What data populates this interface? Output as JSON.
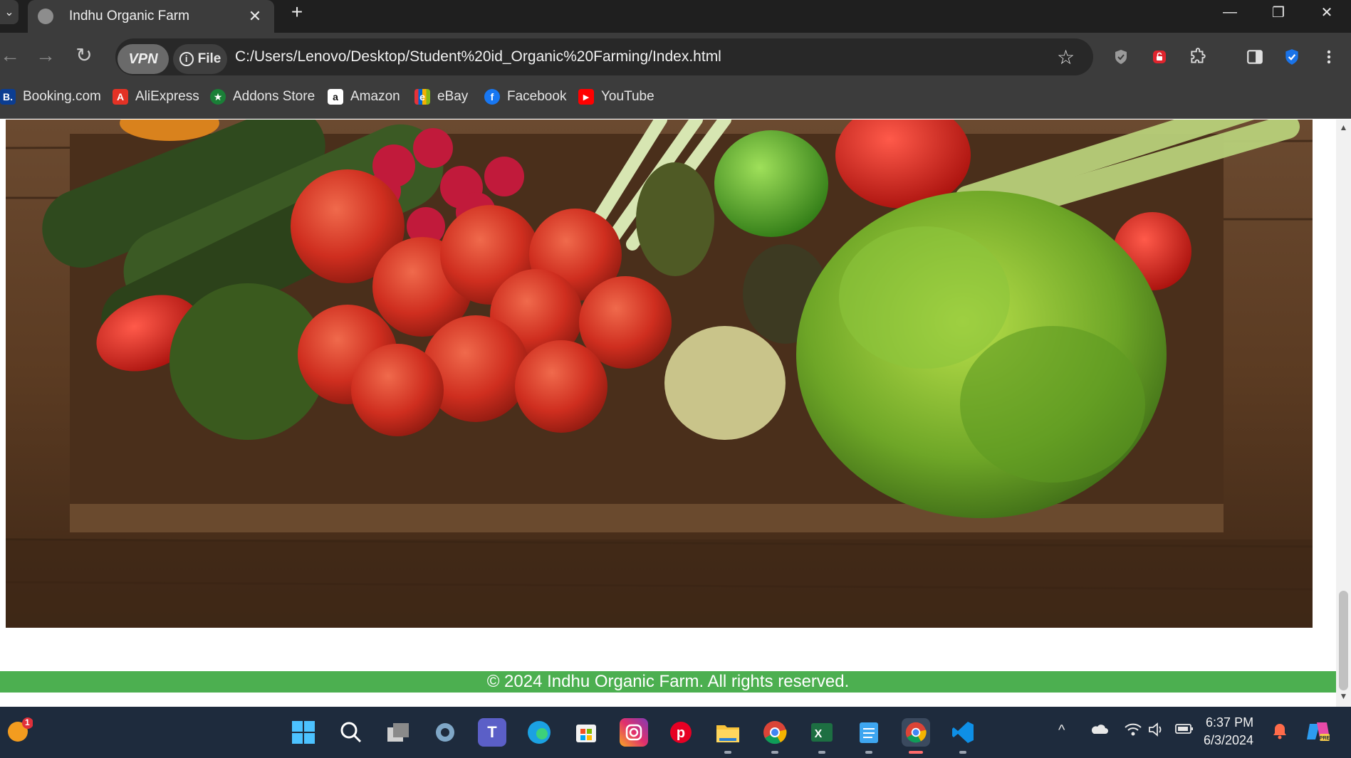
{
  "browser": {
    "tab_title": "Indhu Organic Farm",
    "tab_close": "✕",
    "new_tab": "+",
    "vpn_label": "VPN",
    "file_label": "File",
    "url": "C:/Users/Lenovo/Desktop/Student%20id_Organic%20Farming/Index.html",
    "window": {
      "minimize": "—",
      "restore": "❐",
      "close": "✕"
    },
    "nav": {
      "back": "←",
      "forward": "→",
      "reload": "↻"
    },
    "star": "☆",
    "extensions": [
      "shield-extension-icon",
      "lock-extension-icon",
      "puzzle-icon",
      "side-panel-icon",
      "shield-check-icon",
      "kebab-menu-icon"
    ]
  },
  "bookmarks": [
    {
      "label": "Booking.com",
      "icon": "B.",
      "color": "#0b3d91"
    },
    {
      "label": "AliExpress",
      "icon": "A",
      "color": "#e43225"
    },
    {
      "label": "Addons Store",
      "icon": "★",
      "color": "#1a7f37"
    },
    {
      "label": "Amazon",
      "icon": "a",
      "color": "#ffffff"
    },
    {
      "label": "eBay",
      "icon": "e",
      "color": "#e53238"
    },
    {
      "label": "Facebook",
      "icon": "f",
      "color": "#1877f2"
    },
    {
      "label": "YouTube",
      "icon": "▶",
      "color": "#ff0000"
    }
  ],
  "page": {
    "footer": "© 2024 Indhu Organic Farm. All rights reserved."
  },
  "taskbar": {
    "time": "6:37 PM",
    "date": "6/3/2024",
    "notification_count": "1",
    "apps": [
      "windows-start-icon",
      "search-icon",
      "task-view-icon",
      "settings-icon",
      "teams-icon",
      "edge-icon",
      "store-icon",
      "instagram-icon",
      "pinterest-icon",
      "file-explorer-icon",
      "chrome-icon",
      "excel-icon",
      "notepad-icon",
      "chrome-vpn-icon",
      "vscode-icon"
    ],
    "tray": [
      "chevron-up-icon",
      "onedrive-icon",
      "wifi-icon",
      "volume-icon",
      "battery-icon",
      "bell-icon",
      "copilot-icon"
    ]
  },
  "colors": {
    "footer_bg": "#4caf50",
    "chrome_dark": "#1f1f1f",
    "chrome_toolbar": "#3c3c3c",
    "taskbar_bg": "#1e2b3d"
  }
}
